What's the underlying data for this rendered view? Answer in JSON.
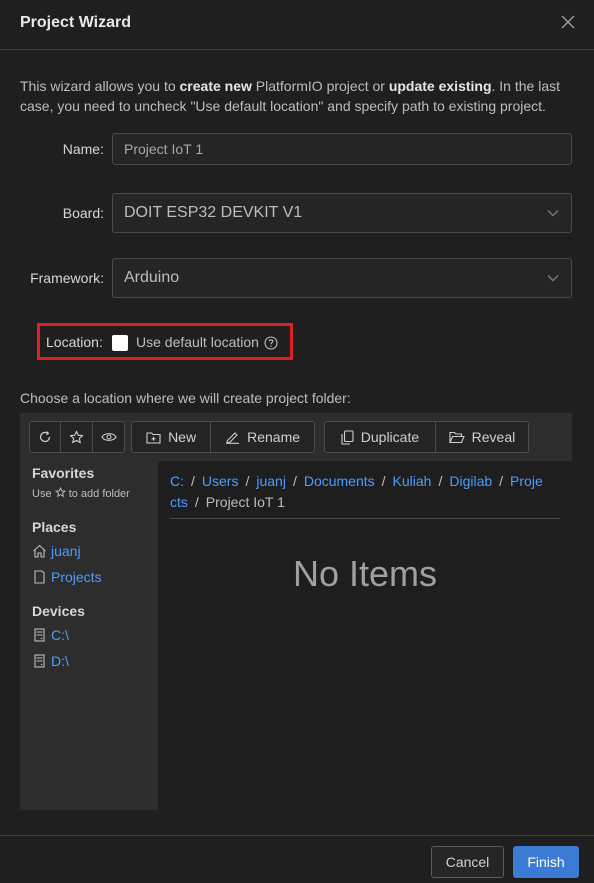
{
  "dialog": {
    "title": "Project Wizard"
  },
  "intro": {
    "p1": "This wizard allows you to ",
    "b1": "create new",
    "p2": " PlatformIO project or ",
    "b2": "update existing",
    "p3": ". In the last case, you need to uncheck \"Use default location\" and specify path to existing project."
  },
  "form": {
    "name_label": "Name",
    "name_value": "Project IoT 1",
    "board_label": "Board",
    "board_value": "DOIT ESP32 DEVKIT V1",
    "framework_label": "Framework",
    "framework_value": "Arduino",
    "location_label": "Location",
    "use_default_location": "Use default location",
    "use_default_checked": false
  },
  "chooser": {
    "prompt": "Choose a location where we will create project folder:",
    "toolbar": {
      "new": "New",
      "rename": "Rename",
      "duplicate": "Duplicate",
      "reveal": "Reveal"
    },
    "sidebar": {
      "favorites_title": "Favorites",
      "favorites_hint_pre": "Use",
      "favorites_hint_post": "to add folder",
      "places_title": "Places",
      "places": [
        "juanj",
        "Projects"
      ],
      "devices_title": "Devices",
      "devices": [
        "C:\\",
        "D:\\"
      ]
    },
    "breadcrumb": [
      "C:",
      "Users",
      "juanj",
      "Documents",
      "Kuliah",
      "Digilab",
      "Proje",
      "cts",
      "Project IoT 1"
    ],
    "empty_text": "No Items"
  },
  "footer": {
    "cancel": "Cancel",
    "finish": "Finish"
  },
  "colors": {
    "accent": "#3b7bd4",
    "link": "#4f9cff",
    "highlight_border": "#e01e26",
    "background": "#1f1f1f"
  }
}
